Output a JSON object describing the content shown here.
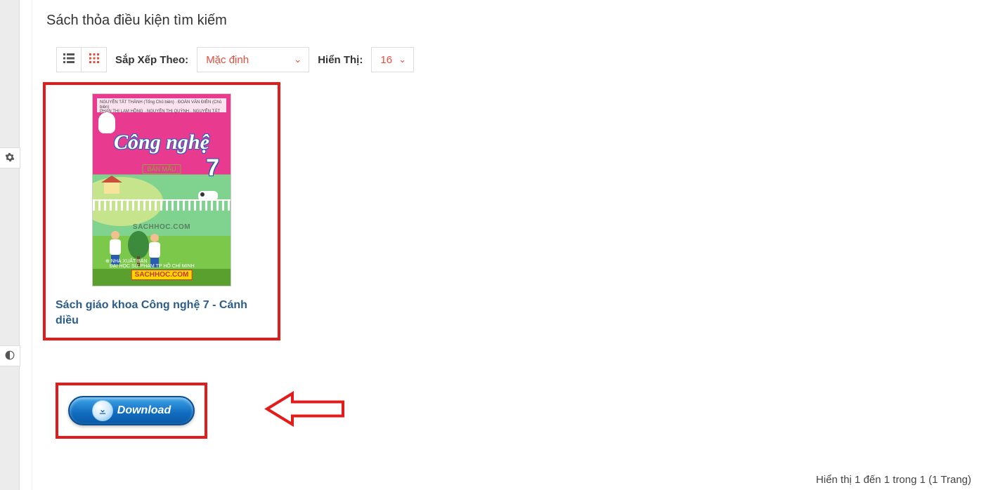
{
  "page": {
    "heading": "Sách thỏa điều kiện tìm kiếm"
  },
  "toolbar": {
    "sort_label": "Sắp Xếp Theo:",
    "sort_value": "Mặc định",
    "show_label": "Hiển Thị:",
    "show_value": "16"
  },
  "product": {
    "title": "Sách giáo khoa Công nghệ 7 - Cánh diều",
    "cover": {
      "subject": "Công nghệ",
      "grade": "7",
      "tag": "BẢN MẪU",
      "watermark": "SACHHOC.COM",
      "watermark_badge": "SACHHOC.COM"
    }
  },
  "download": {
    "label": "Download"
  },
  "pagination": {
    "info": "Hiển thị 1 đến 1 trong 1 (1 Trang)"
  }
}
